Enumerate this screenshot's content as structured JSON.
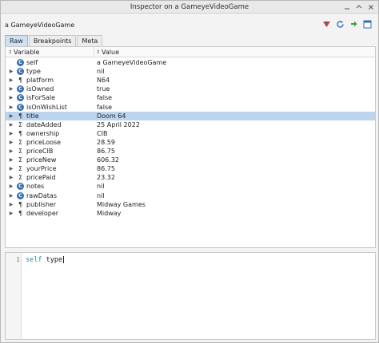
{
  "window": {
    "title": "Inspector on a GameyeVideoGame"
  },
  "header": {
    "object_title": "a GameyeVideoGame",
    "icons": [
      "color-palette-icon",
      "refresh-icon",
      "browse-arrow-icon",
      "window-menu-icon"
    ]
  },
  "tabs": [
    {
      "label": "Raw",
      "active": true
    },
    {
      "label": "Breakpoints",
      "active": false
    },
    {
      "label": "Meta",
      "active": false
    }
  ],
  "table": {
    "columns": {
      "variable": "Variable",
      "value": "Value"
    },
    "rows": [
      {
        "kind": "C",
        "name": "self",
        "value": "a GameyeVideoGame",
        "expandable": false
      },
      {
        "kind": "C",
        "name": "type",
        "value": "nil",
        "expandable": true
      },
      {
        "kind": "¶",
        "name": "platform",
        "value": "N64",
        "expandable": true
      },
      {
        "kind": "C",
        "name": "isOwned",
        "value": "true",
        "expandable": true
      },
      {
        "kind": "C",
        "name": "isForSale",
        "value": "false",
        "expandable": true
      },
      {
        "kind": "C",
        "name": "isOnWishList",
        "value": "false",
        "expandable": true
      },
      {
        "kind": "¶",
        "name": "title",
        "value": "Doom 64",
        "expandable": true,
        "selected": true
      },
      {
        "kind": "Σ",
        "name": "dateAdded",
        "value": "25 April 2022",
        "expandable": true
      },
      {
        "kind": "¶",
        "name": "ownership",
        "value": "CIB",
        "expandable": true
      },
      {
        "kind": "Σ",
        "name": "priceLoose",
        "value": "28.59",
        "expandable": true
      },
      {
        "kind": "Σ",
        "name": "priceCIB",
        "value": "86.75",
        "expandable": true
      },
      {
        "kind": "Σ",
        "name": "priceNew",
        "value": "606.32",
        "expandable": true
      },
      {
        "kind": "Σ",
        "name": "yourPrice",
        "value": "86.75",
        "expandable": true
      },
      {
        "kind": "Σ",
        "name": "pricePaid",
        "value": "23.32",
        "expandable": true
      },
      {
        "kind": "C",
        "name": "notes",
        "value": "nil",
        "expandable": true
      },
      {
        "kind": "C",
        "name": "rawDatas",
        "value": "nil",
        "expandable": true
      },
      {
        "kind": "¶",
        "name": "publisher",
        "value": "Midway Games",
        "expandable": true
      },
      {
        "kind": "¶",
        "name": "developer",
        "value": "Midway",
        "expandable": true
      }
    ]
  },
  "code": {
    "line_number": "1",
    "keyword": "self",
    "rest": " type"
  },
  "colors": {
    "selection": "#bcd4ee",
    "active_tab": "#cfe1f5",
    "class_icon": "#3a6fb0",
    "keyword": "#2a8fa8"
  }
}
